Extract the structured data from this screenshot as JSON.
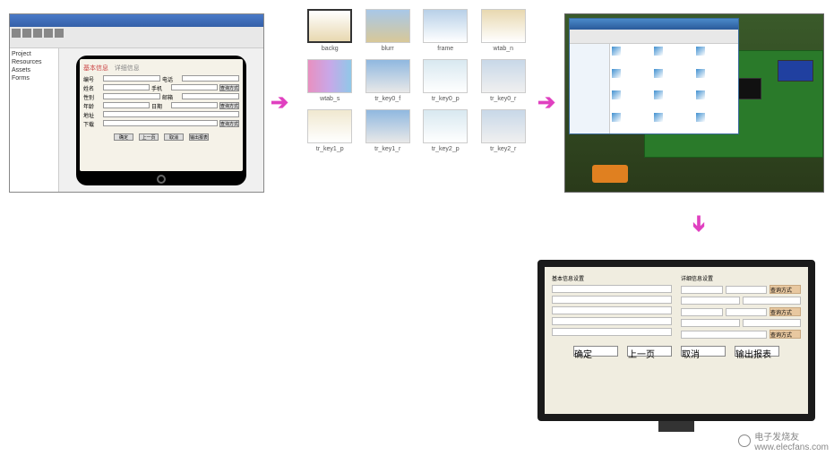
{
  "diagram": {
    "description": "GUI design-to-device deployment workflow",
    "flow": [
      "ide-design",
      "assets-export",
      "file-transfer-board",
      "monitor-output"
    ]
  },
  "ide": {
    "tree": [
      "Project",
      "Resources",
      "Assets",
      "Forms"
    ],
    "form": {
      "header": "基本信息",
      "tab2": "详细信息",
      "fields": [
        "编号",
        "姓名",
        "性别",
        "年龄",
        "地址",
        "下载"
      ],
      "fields_r": [
        "电话",
        "手机",
        "邮箱",
        "日期"
      ],
      "btn_query": "查询方式",
      "actions": [
        "确定",
        "上一页",
        "取消",
        "输出报表"
      ]
    }
  },
  "assets": [
    {
      "name": "backg",
      "cls": "g-sel"
    },
    {
      "name": "blurr",
      "cls": "g-blue-tan"
    },
    {
      "name": "frame",
      "cls": "g-blue-wht"
    },
    {
      "name": "wtab_n",
      "cls": "g-tan"
    },
    {
      "name": "wtab_s",
      "cls": "g-pink"
    },
    {
      "name": "tr_key0_f",
      "cls": "g-blue2"
    },
    {
      "name": "tr_key0_p",
      "cls": "g-lt1"
    },
    {
      "name": "tr_key0_r",
      "cls": "g-lt2"
    },
    {
      "name": "tr_key1_p",
      "cls": "g-cream"
    },
    {
      "name": "tr_key1_r",
      "cls": "g-blue2"
    },
    {
      "name": "tr_key2_p",
      "cls": "g-lt1"
    },
    {
      "name": "tr_key2_r",
      "cls": "g-lt2"
    }
  ],
  "explorer": {
    "file_count": 12
  },
  "monitor": {
    "sections": [
      "基本信息设置",
      "详细信息设置"
    ],
    "btn_side": "查询方式",
    "bottom_buttons": [
      "确定",
      "上一页",
      "取消",
      "输出报表"
    ]
  },
  "watermark": {
    "brand": "电子发烧友",
    "url": "www.elecfans.com"
  }
}
